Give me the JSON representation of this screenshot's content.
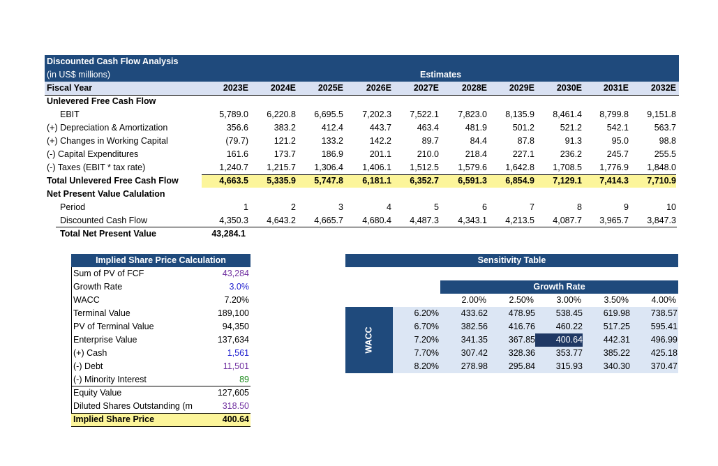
{
  "dcf": {
    "title": "Discounted Cash Flow Analysis",
    "subtitle": "(in US$ millions)",
    "estimates_label": "Estimates",
    "fiscal_year_label": "Fiscal Year",
    "years": [
      "2023E",
      "2024E",
      "2025E",
      "2026E",
      "2027E",
      "2028E",
      "2029E",
      "2030E",
      "2031E",
      "2032E"
    ],
    "ufcf_section": "Unlevered Free Cash Flow",
    "rows": [
      {
        "label": "EBIT",
        "values": [
          "5,789.0",
          "6,220.8",
          "6,695.5",
          "7,202.3",
          "7,522.1",
          "7,823.0",
          "8,135.9",
          "8,461.4",
          "8,799.8",
          "9,151.8"
        ]
      },
      {
        "label": "(+) Depreciation & Amortization",
        "values": [
          "356.6",
          "383.2",
          "412.4",
          "443.7",
          "463.4",
          "481.9",
          "501.2",
          "521.2",
          "542.1",
          "563.7"
        ]
      },
      {
        "label": "(+) Changes in Working Capital",
        "values": [
          "(79.7)",
          "121.2",
          "133.2",
          "142.2",
          "89.7",
          "84.4",
          "87.8",
          "91.3",
          "95.0",
          "98.8"
        ]
      },
      {
        "label": "(-) Capital Expenditures",
        "values": [
          "161.6",
          "173.7",
          "186.9",
          "201.1",
          "210.0",
          "218.4",
          "227.1",
          "236.2",
          "245.7",
          "255.5"
        ]
      },
      {
        "label": "(-) Taxes (EBIT * tax rate)",
        "values": [
          "1,240.7",
          "1,215.7",
          "1,306.4",
          "1,406.1",
          "1,512.5",
          "1,579.6",
          "1,642.8",
          "1,708.5",
          "1,776.9",
          "1,848.0"
        ]
      }
    ],
    "total_ufcf": {
      "label": "Total Unlevered Free Cash Flow",
      "values": [
        "4,663.5",
        "5,335.9",
        "5,747.8",
        "6,181.1",
        "6,352.7",
        "6,591.3",
        "6,854.9",
        "7,129.1",
        "7,414.3",
        "7,710.9"
      ]
    },
    "npv_section": "Net Present Value Calulation",
    "period": {
      "label": "Period",
      "values": [
        "1",
        "2",
        "3",
        "4",
        "5",
        "6",
        "7",
        "8",
        "9",
        "10"
      ]
    },
    "dcf_row": {
      "label": "Discounted Cash Flow",
      "values": [
        "4,350.3",
        "4,643.2",
        "4,665.7",
        "4,680.4",
        "4,487.3",
        "4,343.1",
        "4,213.5",
        "4,087.7",
        "3,965.7",
        "3,847.3"
      ]
    },
    "total_npv": {
      "label": "Total Net Present Value",
      "value": "43,284.1"
    }
  },
  "implied": {
    "title": "Implied Share Price Calculation",
    "rows": [
      {
        "label": "Sum of PV of FCF",
        "value": "43,284",
        "color": "#7030a0"
      },
      {
        "label": "Growth Rate",
        "value": "3.0%",
        "color": "#1f1fcf"
      },
      {
        "label": "WACC",
        "value": "7.20%",
        "color": "#000000"
      },
      {
        "label": "Terminal Value",
        "value": "189,100",
        "color": "#000000"
      },
      {
        "label": "PV of Terminal Value",
        "value": "94,350",
        "color": "#000000"
      },
      {
        "label": "Enterprise Value",
        "value": "137,634",
        "color": "#000000"
      },
      {
        "label": "(+) Cash",
        "value": "1,561",
        "color": "#1f1fcf"
      },
      {
        "label": "(-) Debt",
        "value": "11,501",
        "color": "#7030a0"
      },
      {
        "label": "(-) Minority Interest",
        "value": "89",
        "color": "#1a8a1a"
      },
      {
        "label": "Equity Value",
        "value": "127,605",
        "color": "#000000"
      },
      {
        "label": "Diluted Shares Outstanding (m",
        "value": "318.50",
        "color": "#7030a0"
      }
    ],
    "result": {
      "label": "Implied Share Price",
      "value": "400.64"
    }
  },
  "sensitivity": {
    "title": "Sensitivity Table",
    "growth_label": "Growth Rate",
    "wacc_label": "WACC",
    "growth_rates": [
      "2.00%",
      "2.50%",
      "3.00%",
      "3.50%",
      "4.00%"
    ],
    "waccs": [
      "6.20%",
      "6.70%",
      "7.20%",
      "7.70%",
      "8.20%"
    ],
    "values": [
      [
        "433.62",
        "478.95",
        "538.45",
        "619.98",
        "738.57"
      ],
      [
        "382.56",
        "416.76",
        "460.22",
        "517.25",
        "595.41"
      ],
      [
        "341.35",
        "367.85",
        "400.64",
        "442.31",
        "496.99"
      ],
      [
        "307.42",
        "328.36",
        "353.77",
        "385.22",
        "425.18"
      ],
      [
        "278.98",
        "295.84",
        "315.93",
        "340.30",
        "370.47"
      ]
    ],
    "highlight": [
      2,
      2
    ]
  }
}
